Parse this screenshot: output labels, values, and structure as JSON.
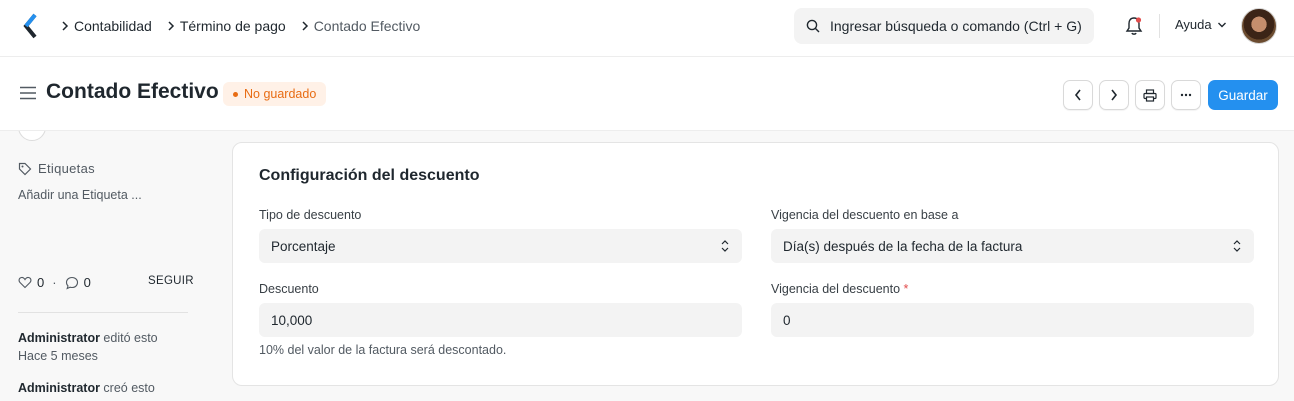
{
  "navbar": {
    "breadcrumbs": [
      "Contabilidad",
      "Término de pago",
      "Contado Efectivo"
    ],
    "search_placeholder": "Ingresar búsqueda o comando (Ctrl + G)",
    "help_label": "Ayuda"
  },
  "header": {
    "title": "Contado Efectivo",
    "status_badge": "No guardado",
    "save_label": "Guardar"
  },
  "sidebar": {
    "tags_label": "Etiquetas",
    "add_tag": "Añadir una Etiqueta ...",
    "likes_count": "0",
    "comments_count": "0",
    "follow_label": "SEGUIR",
    "activity": [
      {
        "user": "Administrator",
        "action": " editó esto",
        "time": "Hace 5 meses"
      },
      {
        "user": "Administrator",
        "action": " creó esto",
        "time": ""
      }
    ]
  },
  "form": {
    "section_title": "Configuración del descuento",
    "discount_type_label": "Tipo de descuento",
    "discount_type_value": "Porcentaje",
    "discount_validity_based_on_label": "Vigencia del descuento en base a",
    "discount_validity_based_on_value": "Día(s) después de la fecha de la factura",
    "discount_label": "Descuento",
    "discount_value": "10,000",
    "discount_help": "10% del valor de la factura será descontado.",
    "discount_validity_label": "Vigencia del descuento",
    "discount_validity_value": "0",
    "required_mark": "*"
  },
  "colors": {
    "primary": "#2490ef",
    "badge_text": "#e86c13",
    "badge_bg": "#fff1e7"
  }
}
